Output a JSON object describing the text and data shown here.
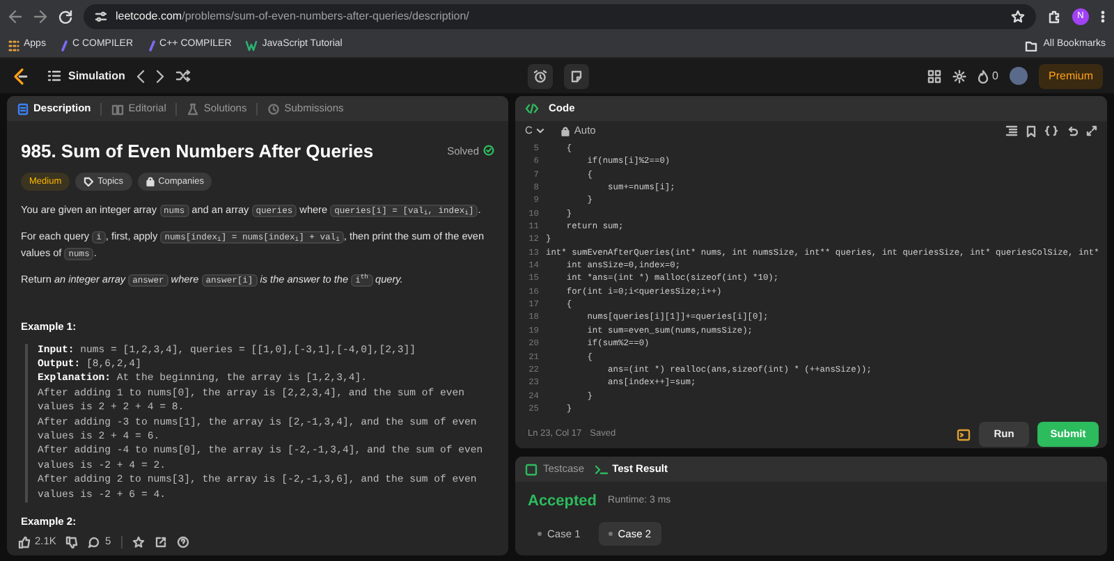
{
  "browser": {
    "url_host": "leetcode.com",
    "url_path": "/problems/sum-of-even-numbers-after-queries/description/",
    "avatar": "N",
    "bookmarks": [
      {
        "label": "Apps",
        "kind": "apps"
      },
      {
        "label": "C COMPILER",
        "kind": "compiler"
      },
      {
        "label": "C++ COMPILER",
        "kind": "compiler"
      },
      {
        "label": "JavaScript Tutorial",
        "kind": "tutorial"
      }
    ],
    "all_bookmarks": "All Bookmarks"
  },
  "header": {
    "list_title": "Simulation",
    "streak": "0",
    "premium": "Premium"
  },
  "description_panel": {
    "tabs": [
      {
        "label": "Description",
        "selected": true
      },
      {
        "label": "Editorial",
        "selected": false
      },
      {
        "label": "Solutions",
        "selected": false
      },
      {
        "label": "Submissions",
        "selected": false
      }
    ],
    "title": "985. Sum of Even Numbers After Queries",
    "status": "Solved",
    "tags": [
      {
        "label": "Medium",
        "kind": "difficulty"
      },
      {
        "label": "Topics",
        "kind": "topics"
      },
      {
        "label": "Companies",
        "kind": "companies"
      }
    ],
    "paragraphs": [
      [
        {
          "kind": "text",
          "text": "You are given an integer array "
        },
        {
          "kind": "code",
          "text": "nums"
        },
        {
          "kind": "text",
          "text": " and an array "
        },
        {
          "kind": "code",
          "text": "queries"
        },
        {
          "kind": "text",
          "text": " where "
        },
        {
          "kind": "code",
          "text": "queries[i] = [val$_{i}$, index$_{i}$]"
        },
        {
          "kind": "text",
          "text": "."
        }
      ],
      [
        {
          "kind": "text",
          "text": "For each query "
        },
        {
          "kind": "code",
          "text": "i"
        },
        {
          "kind": "text",
          "text": ", first, apply "
        },
        {
          "kind": "code",
          "text": "nums[index$_{i}$] = nums[index$_{i}$] + val$_{i}$"
        },
        {
          "kind": "text",
          "text": ", then print the sum of the even values of "
        },
        {
          "kind": "code",
          "text": "nums"
        },
        {
          "kind": "text",
          "text": "."
        }
      ],
      [
        {
          "kind": "text",
          "text": "Return "
        },
        {
          "kind": "italic",
          "text": "an integer array "
        },
        {
          "kind": "code",
          "text": "answer"
        },
        {
          "kind": "italic",
          "text": " where "
        },
        {
          "kind": "code",
          "text": "answer[i]"
        },
        {
          "kind": "italic",
          "text": " is the answer to the "
        },
        {
          "kind": "code",
          "text": "i$^{th}$"
        },
        {
          "kind": "italic",
          "text": " query."
        }
      ]
    ],
    "example_title": "Example 1:",
    "example_lines": [
      "**Input:** nums = [1,2,3,4], queries = [[1,0],[-3,1],[-4,0],[2,3]]",
      "**Output:** [8,6,2,4]",
      "**Explanation:** At the beginning, the array is [1,2,3,4].",
      "After adding 1 to nums[0], the array is [2,2,3,4], and the sum of even values is 2 + 2 + 4 = 8.",
      "After adding -3 to nums[1], the array is [2,-1,3,4], and the sum of even values is 2 + 4 = 6.",
      "After adding -4 to nums[0], the array is [-2,-1,3,4], and the sum of even values is -2 + 4 = 2.",
      "After adding 2 to nums[3], the array is [-2,-1,3,6], and the sum of even values is -2 + 6 = 4."
    ],
    "next_example_title": "Example 2:",
    "likes": "2.1K",
    "comments": "5"
  },
  "code_panel": {
    "title": "Code",
    "language": "C",
    "mode": "Auto",
    "lines": [
      {
        "number": "5",
        "text": "    {"
      },
      {
        "number": "6",
        "text": "        if(nums[i]%2==0)"
      },
      {
        "number": "7",
        "text": "        {"
      },
      {
        "number": "8",
        "text": "            sum+=nums[i];"
      },
      {
        "number": "9",
        "text": "        }"
      },
      {
        "number": "10",
        "text": "    }"
      },
      {
        "number": "11",
        "text": "    return sum;"
      },
      {
        "number": "12",
        "text": "}"
      },
      {
        "number": "13",
        "text": "int* sumEvenAfterQueries(int* nums, int numsSize, int** queries, int queriesSize, int* queriesColSize, int*"
      },
      {
        "number": "14",
        "text": "    int ansSize=0,index=0;"
      },
      {
        "number": "15",
        "text": "    int *ans=(int *) malloc(sizeof(int) *10);"
      },
      {
        "number": "16",
        "text": "    for(int i=0;i<queriesSize;i++)"
      },
      {
        "number": "17",
        "text": "    {"
      },
      {
        "number": "18",
        "text": "        nums[queries[i][1]]+=queries[i][0];"
      },
      {
        "number": "19",
        "text": "        int sum=even_sum(nums,numsSize);"
      },
      {
        "number": "20",
        "text": "        if(sum%2==0)"
      },
      {
        "number": "21",
        "text": "        {"
      },
      {
        "number": "22",
        "text": "            ans=(int *) realloc(ans,sizeof(int) * (++ansSize));"
      },
      {
        "number": "23",
        "text": "            ans[index++]=sum;"
      },
      {
        "number": "24",
        "text": "        }"
      },
      {
        "number": "25",
        "text": "    }"
      }
    ],
    "position": "Ln 23, Col 17",
    "saved": "Saved",
    "buttons": [
      {
        "label": "Run",
        "kind": "run"
      },
      {
        "label": "Submit",
        "kind": "submit"
      }
    ]
  },
  "result_panel": {
    "tabs": [
      {
        "label": "Testcase",
        "selected": false
      },
      {
        "label": "Test Result",
        "selected": true
      }
    ],
    "verdict": "Accepted",
    "runtime": "Runtime: 3 ms",
    "cases": [
      {
        "label": "Case 1",
        "selected": false
      },
      {
        "label": "Case 2",
        "selected": true
      }
    ]
  }
}
